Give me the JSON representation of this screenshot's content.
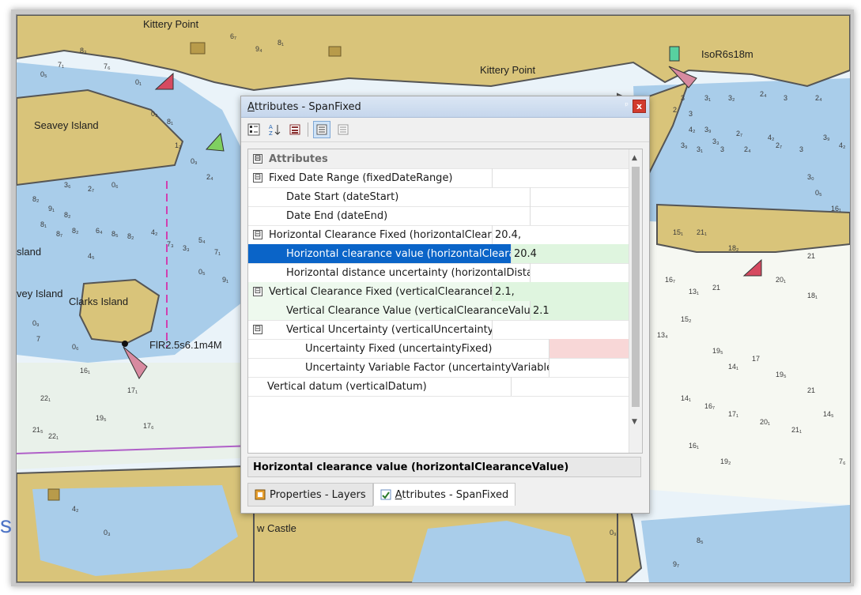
{
  "map": {
    "place_labels": [
      "Kittery Point",
      "Kittery Point",
      "Seavey Island",
      "Clarks Island",
      "vey Island",
      "sland",
      "w Castle"
    ],
    "light_labels": [
      "IsoR6s18m",
      "FlR2.5s6.1m4M"
    ],
    "soundings": [
      "0₅",
      "7₁",
      "8₃",
      "7₆",
      "0₁",
      "6₇",
      "9₄",
      "8₁",
      "0₃",
      "8₁",
      "1₂",
      "0₉",
      "2₄",
      "3₆",
      "2₇",
      "0₆",
      "8₂",
      "9₁",
      "8₂",
      "8₁",
      "8₇",
      "8₂",
      "6₄",
      "8₅",
      "8₂",
      "4₂",
      "7₃",
      "3₃",
      "5₄",
      "7₁",
      "4₅",
      "0₅",
      "9₁",
      "0₉",
      "7",
      "0₆",
      "16₁",
      "17₁",
      "22₁",
      "21₅",
      "22₁",
      "19₅",
      "17₆",
      "3",
      "2",
      "3",
      "3₁",
      "3₂",
      "2₄",
      "3",
      "2₄",
      "4₂",
      "3₉",
      "3₃",
      "2₇",
      "4₂",
      "3₉",
      "3₁",
      "3",
      "2₄",
      "2₇",
      "3",
      "3₉",
      "4₂",
      "3₀",
      "0₅",
      "16₁",
      "15₁",
      "21₁",
      "18₂",
      "21",
      "16₇",
      "13₁",
      "21",
      "20₁",
      "18₁",
      "13₄",
      "15₂",
      "19₅",
      "14₁",
      "17",
      "19₅",
      "21",
      "14₁",
      "16₇",
      "17₁",
      "20₁",
      "21₁",
      "14₅",
      "16₁",
      "19₂",
      "8₅",
      "9₇",
      "0₃",
      "4₂",
      "0₉",
      "0₃",
      "7₆",
      "9₄",
      "3₂"
    ]
  },
  "stray_text": "s",
  "panel": {
    "title_prefix": "A",
    "title_rest": "ttributes - SpanFixed",
    "pin_glyph": "ᵖ",
    "close_glyph": "x",
    "toolbar": [
      "categorized-icon",
      "alphabetical-sort-icon",
      "property-pages-icon",
      "show-values-icon",
      "hide-values-icon"
    ],
    "rows": [
      {
        "toggle": "⊟",
        "name": "Attributes",
        "value": ""
      },
      {
        "toggle": "⊟",
        "name": "Fixed Date Range (fixedDateRange)",
        "value": ""
      },
      {
        "toggle": "",
        "name": "Date Start (dateStart)",
        "value": ""
      },
      {
        "toggle": "",
        "name": "Date End (dateEnd)",
        "value": ""
      },
      {
        "toggle": "⊟",
        "name": "Horizontal Clearance Fixed (horizontalClearanceFixed)",
        "value": "20.4,"
      },
      {
        "toggle": "",
        "name": "Horizontal clearance value (horizontalClearanceValue)",
        "value": "20.4"
      },
      {
        "toggle": "",
        "name": "Horizontal distance uncertainty (horizontalDistanceUncertainty)",
        "value": ""
      },
      {
        "toggle": "⊟",
        "name": "Vertical Clearance Fixed (verticalClearanceFixed)",
        "value": "2.1,"
      },
      {
        "toggle": "",
        "name": "Vertical Clearance Value (verticalClearanceValue)",
        "value": "2.1"
      },
      {
        "toggle": "⊟",
        "name": "Vertical Uncertainty (verticalUncertainty)",
        "value": ""
      },
      {
        "toggle": "",
        "name": "Uncertainty Fixed (uncertaintyFixed)",
        "value": ""
      },
      {
        "toggle": "",
        "name": "Uncertainty Variable Factor (uncertaintyVariableFactor)",
        "value": ""
      },
      {
        "toggle": "",
        "name": "Vertical datum (verticalDatum)",
        "value": ""
      }
    ],
    "description": "Horizontal clearance value (horizontalClearanceValue)",
    "tabs": [
      {
        "label": "Properties - Layers",
        "icon": "layers-icon"
      },
      {
        "underline": "A",
        "label": "ttributes - SpanFixed",
        "icon": "attributes-icon"
      }
    ]
  },
  "colors": {
    "land": "#d9c47a",
    "shallow_water": "#a9cdea",
    "water": "#d6e9f5",
    "deep_water": "#ffffff",
    "intertidal": "#bfd8b0",
    "selection": "#0a64c8",
    "clearance_green": "#dff5df",
    "uncertainty_pink": "#f8d7d7",
    "buoy_red": "#d64a60"
  }
}
